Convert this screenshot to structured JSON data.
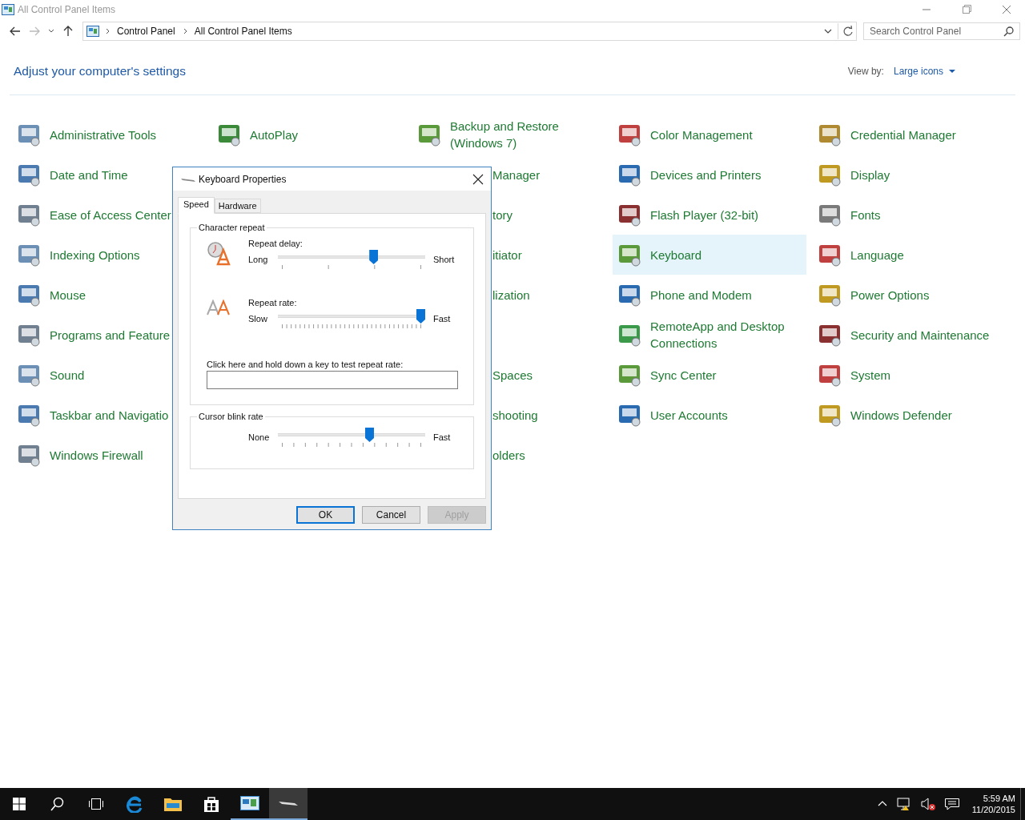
{
  "window": {
    "title": "All Control Panel Items"
  },
  "address_bar": {
    "breadcrumbs": [
      "Control Panel",
      "All Control Panel Items"
    ]
  },
  "search": {
    "placeholder": "Search Control Panel"
  },
  "heading": "Adjust your computer's settings",
  "view_by": {
    "label": "View by:",
    "value": "Large icons"
  },
  "rows": [
    {
      "items": [
        {
          "kind": "full",
          "label": "Administrative Tools",
          "selected": false
        },
        {
          "kind": "full",
          "label": "AutoPlay",
          "selected": false
        },
        {
          "kind": "full",
          "label": "Backup and Restore (Windows 7)",
          "selected": false
        },
        {
          "kind": "full",
          "label": "Color Management",
          "selected": false
        },
        {
          "kind": "full",
          "label": "Credential Manager",
          "selected": false
        }
      ]
    },
    {
      "items": [
        {
          "kind": "full",
          "label": "Date and Time",
          "selected": false
        },
        {
          "kind": "partial",
          "label": "Manager",
          "selected": false
        },
        {
          "kind": "full",
          "label": "Devices and Printers",
          "selected": false
        },
        {
          "kind": "full",
          "label": "Display",
          "selected": false
        }
      ]
    },
    {
      "items": [
        {
          "kind": "full",
          "label": "Ease of Access Center",
          "selected": false
        },
        {
          "kind": "partial",
          "label": "tory",
          "selected": false
        },
        {
          "kind": "full",
          "label": "Flash Player (32-bit)",
          "selected": false
        },
        {
          "kind": "full",
          "label": "Fonts",
          "selected": false
        }
      ]
    },
    {
      "items": [
        {
          "kind": "full",
          "label": "Indexing Options",
          "selected": false
        },
        {
          "kind": "partial",
          "label": "itiator",
          "selected": false
        },
        {
          "kind": "full",
          "label": "Keyboard",
          "selected": true
        },
        {
          "kind": "full",
          "label": "Language",
          "selected": false
        }
      ]
    },
    {
      "items": [
        {
          "kind": "full",
          "label": "Mouse",
          "selected": false
        },
        {
          "kind": "partial",
          "label": "lization",
          "selected": false
        },
        {
          "kind": "full",
          "label": "Phone and Modem",
          "selected": false
        },
        {
          "kind": "full",
          "label": "Power Options",
          "selected": false
        }
      ]
    },
    {
      "items": [
        {
          "kind": "full",
          "label": "Programs and Feature",
          "selected": false
        },
        {
          "kind": "full",
          "label": "RemoteApp and Desktop Connections",
          "selected": false
        },
        {
          "kind": "full",
          "label": "Security and Maintenance",
          "selected": false
        }
      ]
    },
    {
      "items": [
        {
          "kind": "full",
          "label": "Sound",
          "selected": false
        },
        {
          "kind": "partial",
          "label": "Spaces",
          "selected": false
        },
        {
          "kind": "full",
          "label": "Sync Center",
          "selected": false
        },
        {
          "kind": "full",
          "label": "System",
          "selected": false
        }
      ]
    },
    {
      "items": [
        {
          "kind": "full",
          "label": "Taskbar and Navigatio",
          "selected": false
        },
        {
          "kind": "partial",
          "label": "shooting",
          "selected": false
        },
        {
          "kind": "full",
          "label": "User Accounts",
          "selected": false
        },
        {
          "kind": "full",
          "label": "Windows Defender",
          "selected": false
        }
      ]
    },
    {
      "items": [
        {
          "kind": "full",
          "label": "Windows Firewall",
          "selected": false
        },
        {
          "kind": "partial",
          "label": "olders",
          "selected": false
        }
      ]
    }
  ],
  "dialog": {
    "title": "Keyboard Properties",
    "tabs": [
      {
        "label": "Speed",
        "selected": true
      },
      {
        "label": "Hardware",
        "selected": false
      }
    ],
    "character_repeat": {
      "title": "Character repeat",
      "delay": {
        "label": "Repeat delay:",
        "min_label": "Long",
        "max_label": "Short",
        "level": 0.66
      },
      "rate": {
        "label": "Repeat rate:",
        "min_label": "Slow",
        "max_label": "Fast",
        "level": 1
      },
      "test_label": "Click here and hold down a key to test repeat rate:"
    },
    "cursor_blink": {
      "title": "Cursor blink rate",
      "min_label": "None",
      "max_label": "Fast",
      "level": 0.63
    },
    "buttons": [
      {
        "label": "OK",
        "kind": "default",
        "disabled": false
      },
      {
        "label": "Cancel",
        "kind": "normal",
        "disabled": false
      },
      {
        "label": "Apply",
        "kind": "normal",
        "disabled": true
      }
    ]
  },
  "taskbar": {
    "apps": [
      {
        "open": true,
        "active": false
      },
      {
        "open": true,
        "active": true
      }
    ],
    "time": "5:59 AM",
    "date": "11/20/2015"
  }
}
